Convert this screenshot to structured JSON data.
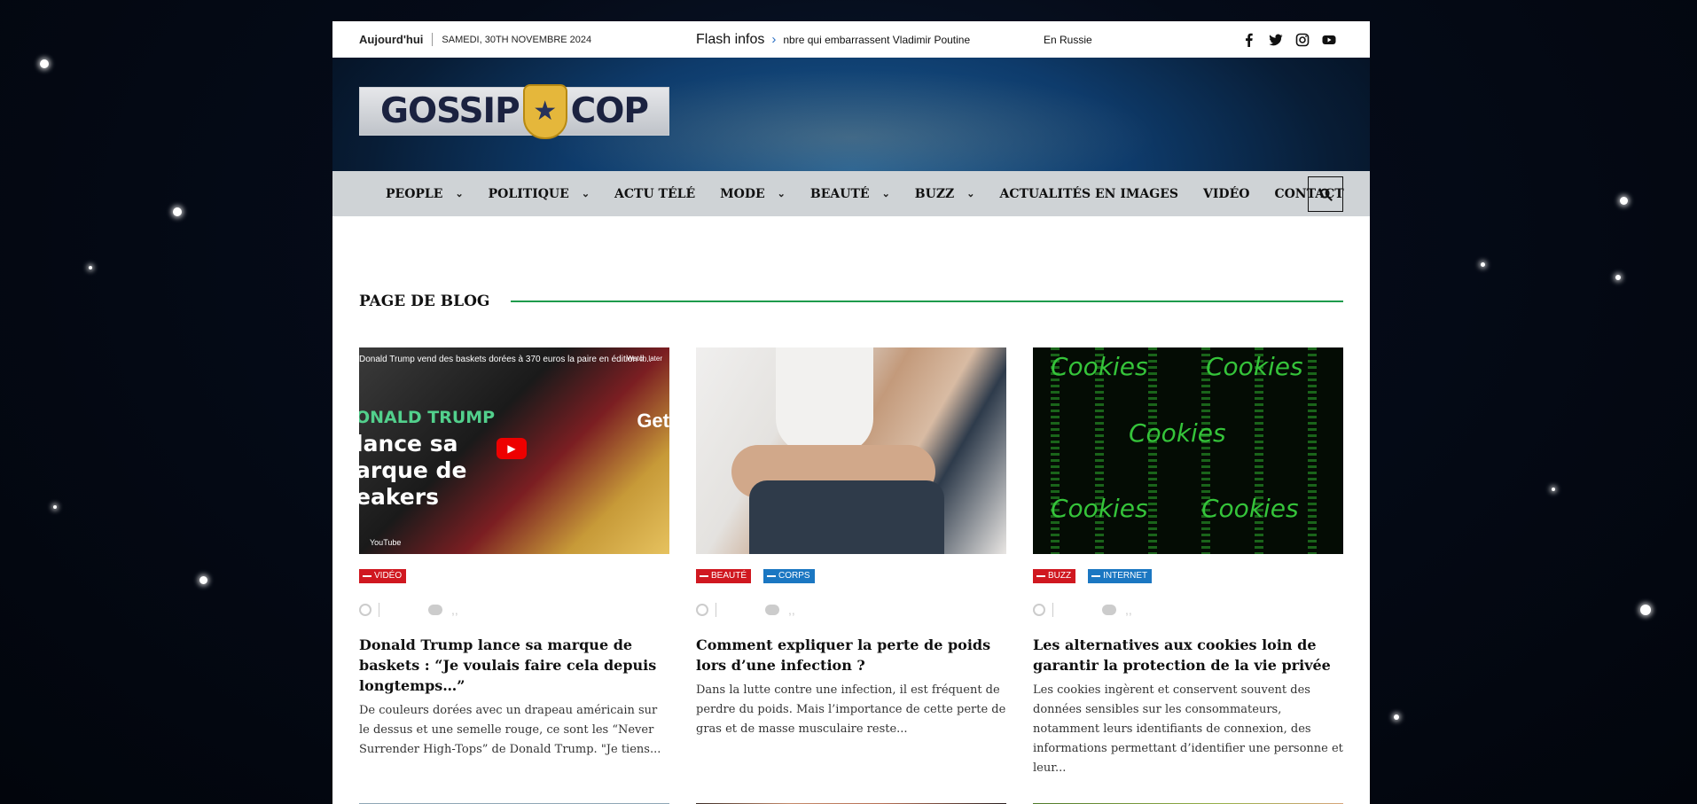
{
  "topbar": {
    "today": "Aujourd'hui",
    "date": "SAMEDI, 30TH NOVEMBRE 2024",
    "flash_label": "Flash infos",
    "flash_text": "nbre qui embarrassent Vladimir Poutine",
    "flash_text_2": "En Russie",
    "socials": [
      "facebook-icon",
      "twitter-icon",
      "instagram-icon",
      "youtube-icon"
    ]
  },
  "logo": {
    "left": "GOSSIP",
    "right": "COP"
  },
  "nav": {
    "items": [
      {
        "label": "PEOPLE",
        "dropdown": true
      },
      {
        "label": "POLITIQUE",
        "dropdown": true
      },
      {
        "label": "ACTU TÉLÉ",
        "dropdown": false
      },
      {
        "label": "MODE",
        "dropdown": true
      },
      {
        "label": "BEAUTÉ",
        "dropdown": true
      },
      {
        "label": "BUZZ",
        "dropdown": true
      },
      {
        "label": "ACTUALITÉS EN IMAGES",
        "dropdown": false
      },
      {
        "label": "VIDÉO",
        "dropdown": false
      },
      {
        "label": "CONTACT",
        "dropdown": false
      }
    ]
  },
  "section": {
    "title": "PAGE DE BLOG"
  },
  "articles": [
    {
      "thumb_caption": "Donald Trump vend des baskets dorées à 370 euros la paire en édition li...",
      "thumb_overlay": "ONALD TRUMP",
      "thumb_big": "lance sa\narque de\neakers",
      "thumb_tag": "Get",
      "thumb_watch": "Watch later",
      "thumb_yt": "YouTube",
      "tags": [
        {
          "label": "VIDÉO",
          "color": "red"
        }
      ],
      "meta_comments": ",,",
      "title": "Donald Trump lance sa marque de baskets : “Je voulais faire cela depuis longtemps…”",
      "excerpt": "De couleurs dorées avec un drapeau américain sur le dessus et une semelle rouge, ce sont les “Never Surrender High-Tops” de Donald Trump. \"Je tiens..."
    },
    {
      "tags": [
        {
          "label": "BEAUTÉ",
          "color": "red"
        },
        {
          "label": "CORPS",
          "color": "blue"
        }
      ],
      "meta_comments": ",,",
      "title": "Comment expliquer la perte de poids lors d’une infection ?",
      "excerpt": "Dans la lutte contre une infection, il est fréquent de perdre du poids. Mais l’importance de cette perte de gras et de masse musculaire reste..."
    },
    {
      "thumb_word": "Cookies",
      "tags": [
        {
          "label": "BUZZ",
          "color": "red"
        },
        {
          "label": "INTERNET",
          "color": "blue"
        }
      ],
      "meta_comments": ",,",
      "title": "Les alternatives aux cookies loin de garantir la protection de la vie privée",
      "excerpt": "Les cookies ingèrent et conservent souvent des données sensibles sur les consommateurs, notamment leurs identifiants de connexion, des informations permettant d’identifier une personne et leur..."
    }
  ]
}
